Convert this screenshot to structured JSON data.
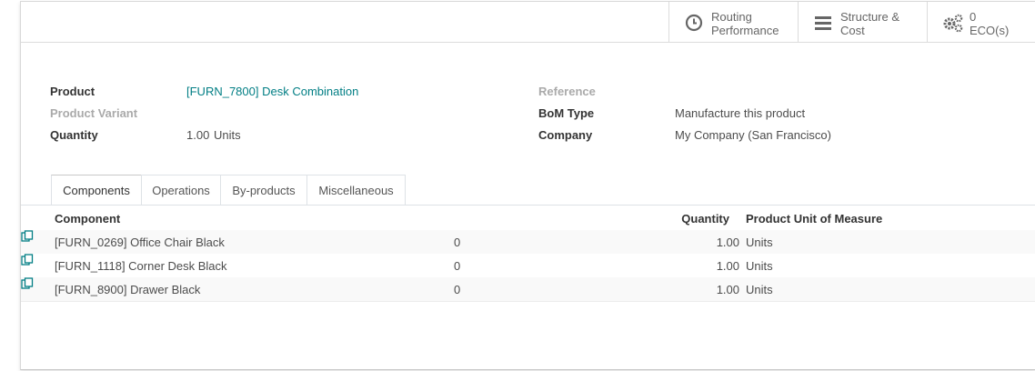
{
  "smart_buttons": {
    "routing": {
      "icon": "clock-icon",
      "line1": "Routing",
      "line2": "Performance"
    },
    "structure": {
      "icon": "list-icon",
      "line1": "Structure &",
      "line2": "Cost"
    },
    "eco": {
      "icon": "gears-icon",
      "line1": "0",
      "line2": "ECO(s)"
    }
  },
  "form": {
    "product_label": "Product",
    "product_value": "[FURN_7800] Desk Combination",
    "variant_label": "Product Variant",
    "quantity_label": "Quantity",
    "quantity_value": "1.00",
    "quantity_unit": "Units",
    "reference_label": "Reference",
    "bom_type_label": "BoM Type",
    "bom_type_value": "Manufacture this product",
    "company_label": "Company",
    "company_value": "My Company (San Francisco)"
  },
  "tabs": [
    "Components",
    "Operations",
    "By-products",
    "Miscellaneous"
  ],
  "table": {
    "headers": {
      "component": "Component",
      "quantity": "Quantity",
      "uom": "Product Unit of Measure"
    },
    "rows": [
      {
        "component": "[FURN_0269] Office Chair Black",
        "count": "0",
        "quantity": "1.00",
        "uom": "Units"
      },
      {
        "component": "[FURN_1118] Corner Desk Black",
        "count": "0",
        "quantity": "1.00",
        "uom": "Units"
      },
      {
        "component": "[FURN_8900] Drawer Black",
        "count": "0",
        "quantity": "1.00",
        "uom": "Units"
      }
    ]
  },
  "colors": {
    "link": "#017e84",
    "muted": "#aaaaaa"
  }
}
